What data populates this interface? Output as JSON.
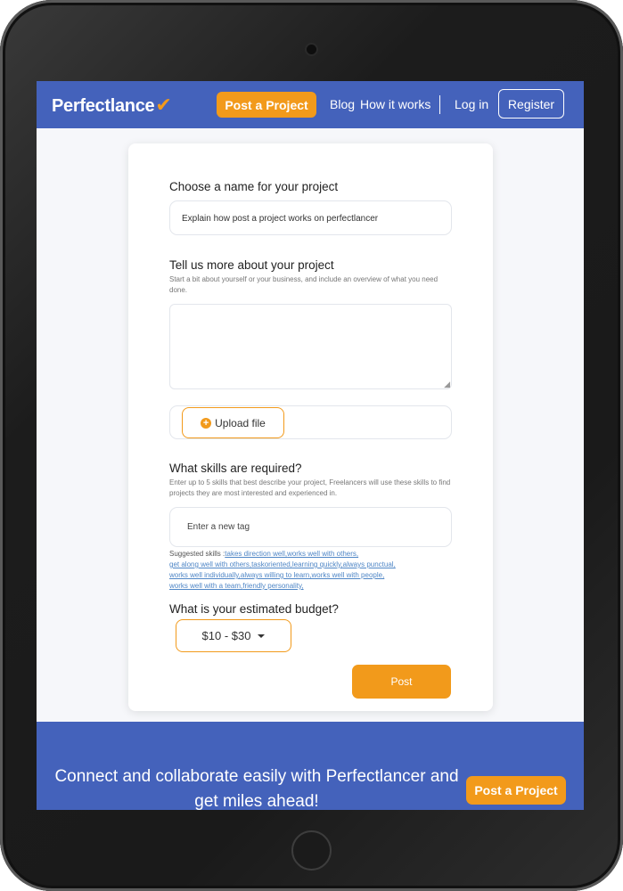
{
  "header": {
    "logo_text": "Perfectlance",
    "logo_mark": "✔",
    "post_project_label": "Post a Project",
    "links": [
      "Blog",
      "How it works"
    ],
    "login_label": "Log in",
    "register_label": "Register"
  },
  "form": {
    "name_label": "Choose a name for your project",
    "name_value": "Explain how post a project works on perfectlancer",
    "details_label": "Tell us more about your project",
    "details_hint": "Start a bit about yourself or your business, and include an overview of what you need done.",
    "details_value": "",
    "upload_label": "Upload file",
    "skills_label": "What skills are required?",
    "skills_hint": "Enter up to 5 skills that best describe your project, Freelancers will use these skills to find projects they are most interested and experienced in.",
    "tag_placeholder": "Enter a new tag",
    "suggested_prefix": "Suggested skills :",
    "suggested_skills": [
      "takes direction well,",
      "works well with others,",
      "get along well with others,",
      "taskoriented,",
      "learning quickly,",
      "always punctual,",
      "works well individually,",
      "always willing to learn,",
      "works well with people,",
      "works well with a team,",
      "friendly personality,"
    ],
    "budget_label": "What is your estimated budget?",
    "budget_value": "$10 - $30",
    "post_label": "Post"
  },
  "banner": {
    "text": "Connect and collaborate easily with Perfectlancer and get miles ahead!",
    "post_project_label": "Post a Project"
  },
  "colors": {
    "brand_blue": "#4462bb",
    "accent_orange": "#f29a1b",
    "link_blue": "#4f86c6"
  }
}
